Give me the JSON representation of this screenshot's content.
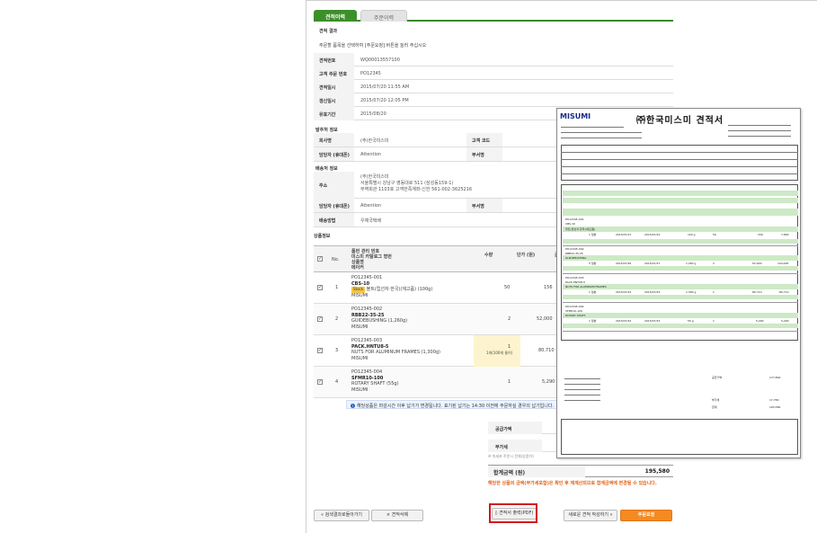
{
  "tabs": [
    {
      "label": "견적이력",
      "active": true
    },
    {
      "label": "주문이력",
      "active": false
    }
  ],
  "result": {
    "heading": "견적 결과",
    "note": "주문할 품목을 선택하여 [주문요청] 버튼을 눌러 주십시오",
    "rows": [
      {
        "key": "견적번호",
        "value": "WQ00013557100"
      },
      {
        "key": "고객 주문 번호",
        "value": "PO12345"
      },
      {
        "key": "견적일시",
        "value": "2015/07/20 11:55 AM"
      },
      {
        "key": "갱신일시",
        "value": "2015/07/20 12:05 PM"
      },
      {
        "key": "유효기간",
        "value": "2015/08/20"
      }
    ]
  },
  "orderer": {
    "heading": "발주처 정보",
    "company_key": "회사명",
    "company_value": "(주)한국미스미",
    "customer_code_key": "고객 코드",
    "contact_key": "담당자 (휴대폰)",
    "contact_value": "Attention",
    "department_key": "부서명"
  },
  "delivery": {
    "heading": "배송처 정보",
    "address_key": "주소",
    "address_lines": [
      "(주)한국미스미",
      "서울특별시 강남구 영동대로 511 (삼성동159-1)",
      "무역회관 1103호 고객만족계좌-신한 561-002-3625216"
    ],
    "contact_key": "담당자 (휴대폰)",
    "contact_value": "Attention",
    "department_key": "부서명",
    "method_key": "배송방법",
    "method_value": "우체국택배"
  },
  "products": {
    "heading": "상품정보",
    "header": {
      "no": "No.",
      "info_lines": [
        "품번 관리 번호",
        "미스미 카탈로그 형번",
        "상품명",
        "메이커"
      ],
      "qty": "수량",
      "unit_price": "단가 (원)",
      "trunc": "금"
    },
    "rows": [
      {
        "no": "1",
        "po": "PO12345-001",
        "part": "CBS-10",
        "stock": "Stock",
        "name": "볼트(립선자·한국)(재고품) (100g)",
        "maker": "MISUMI",
        "qty": "50",
        "qty_note": "",
        "price": "156",
        "checked": true
      },
      {
        "no": "2",
        "po": "PO12345-002",
        "part": "RBB22-35-25",
        "stock": "",
        "name": "GUIDEBUSHING (1,260g)",
        "maker": "MISUMI",
        "qty": "2",
        "qty_note": "",
        "price": "52,000",
        "checked": true
      },
      {
        "no": "3",
        "po": "PO12345-003",
        "part": "PACK.HNTU8-5",
        "stock": "",
        "name": "NUTS FOR ALUMINUM FRAMES (1,300g)",
        "maker": "MISUMI",
        "qty": "1",
        "qty_note": "1개(100개 들이)",
        "price": "80,710",
        "checked": true
      },
      {
        "no": "4",
        "po": "PO12345-004",
        "part": "SFMR10-100",
        "stock": "",
        "name": "ROTARY SHAFT (55g)",
        "maker": "MISUMI",
        "qty": "1",
        "qty_note": "",
        "price": "5,290",
        "checked": true
      }
    ],
    "info_bar": "해당상품은 마감시간 이후 납기가 변경됩니다. 표기된 납기는 14:30 이전에 주문하실 경우의 납기입니다."
  },
  "summary": {
    "rows": [
      "공급가액",
      "부가세"
    ],
    "note": "※ 미세포 주문시 전체(상품이)",
    "total_label": "합계금액 (원)",
    "total_value": "195,580",
    "warning": "해당한 상품의 금액(부가세포함)은 확인 후 재계산되므로 합계금액에 변경될 수 있습니다."
  },
  "buttons": {
    "back": "« 검색결과로돌아가기",
    "delete": "×  견적삭제",
    "pdf": "견적서 출력(PDF)",
    "new_quote": "새로운 견적 작성하기 »",
    "order": "주문요청"
  },
  "quote_doc": {
    "logo": "MISUMI",
    "title": "㈜한국미스미 견적서",
    "items": [
      {
        "po": "PO12345-001",
        "part": "CBS-10",
        "name": "볼트(립선자·한국)(재고품)",
        "qty": "1 일본",
        "d1": "2015/07/21",
        "d2": "2015/07/22",
        "w": "100 g",
        "q": "50",
        "p": "156",
        "amt": "7,800"
      },
      {
        "po": "PO12345-002",
        "part": "RBB22-35-25",
        "name": "GUIDEBUSHING",
        "qty": "5 일본",
        "d1": "2015/07/26",
        "d2": "2015/07/27",
        "w": "1,260 g",
        "q": "2",
        "p": "52,000",
        "amt": "104,000"
      },
      {
        "po": "PO12345-003",
        "part": "PACK.HNTU8-5",
        "name": "NUTS FOR ALUMINUM FRAMES",
        "qty": "1 일본",
        "d1": "2015/07/22",
        "d2": "2015/07/23",
        "w": "1,300 g",
        "q": "1",
        "p": "80,710",
        "amt": "80,710"
      },
      {
        "po": "PO12345-004",
        "part": "SFMR10-100",
        "name": "ROTARY SHAFT",
        "qty": "1 일본",
        "d1": "2015/07/22",
        "d2": "2015/07/23",
        "w": "55 g",
        "q": "1",
        "p": "5,290",
        "amt": "5,290"
      }
    ],
    "totals": [
      {
        "label": "공급가액",
        "value": "177,800"
      },
      {
        "label": "부가세",
        "value": "17,780"
      },
      {
        "label": "합계",
        "value": "195,580"
      }
    ]
  }
}
